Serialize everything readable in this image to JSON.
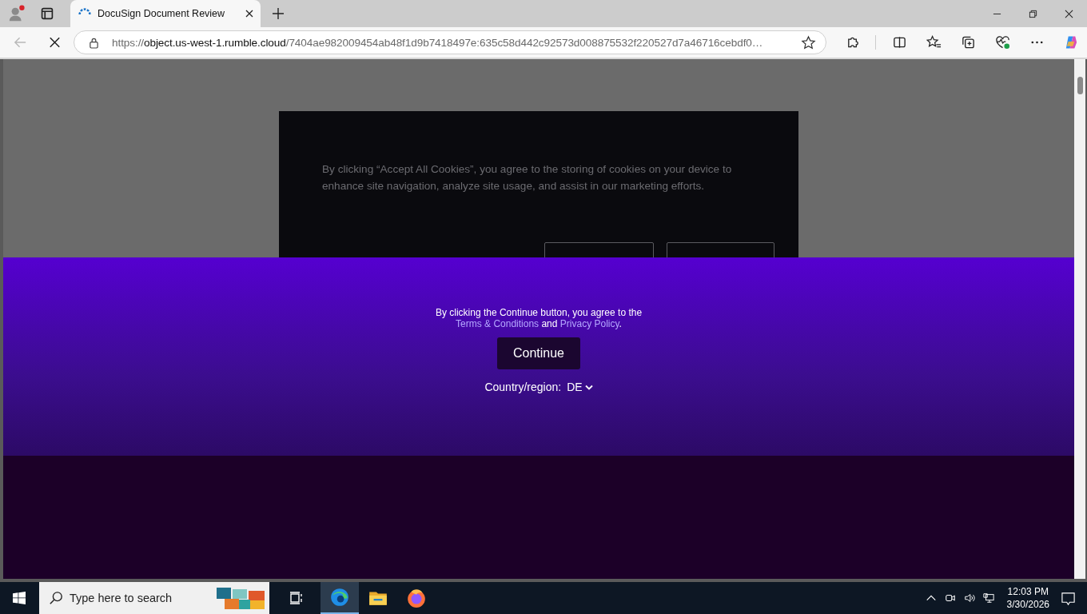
{
  "browser": {
    "tab": {
      "title": "DocuSign Document Review",
      "selected": true
    },
    "address": {
      "scheme": "https://",
      "host": "object.us-west-1.rumble.cloud",
      "path": "/7404ae982009454ab48f1d9b7418497e:635c58d442c92573d008875532f220527d7a46716cebdf0…"
    },
    "back_disabled": true,
    "loading": true
  },
  "cookie_dialog": {
    "text": "By clicking “Accept All Cookies”, you agree to the storing of cookies on your device to enhance site navigation, analyze site usage, and assist in our marketing efforts."
  },
  "consent_banner": {
    "text_before": "By clicking the Continue button, you agree to the ",
    "terms_link": "Terms & Conditions",
    "joiner": " and ",
    "privacy_link": "Privacy Policy",
    "text_after": ".",
    "button": "Continue",
    "country_label": "Country/region:",
    "country_value": "DE"
  },
  "taskbar": {
    "search_placeholder": "Type here to search",
    "time": "12:03 PM",
    "date": "3/30/2026"
  }
}
